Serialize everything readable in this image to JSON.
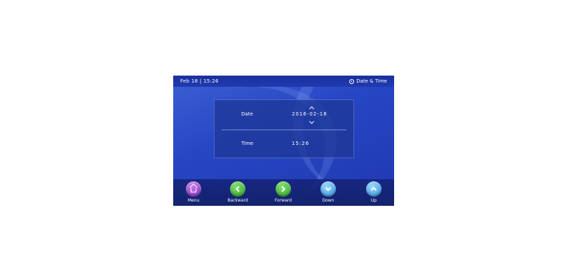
{
  "status_bar": {
    "datetime": "Feb 18 | 15:26",
    "page_title": "Date & Time",
    "page_icon": "clock-icon"
  },
  "settings": {
    "date_label": "Date",
    "date_value": "2016-02-18",
    "time_label": "Time",
    "time_value": "15:26"
  },
  "toolbar": {
    "menu_label": "Menu",
    "backward_label": "Backward",
    "forward_label": "Forward",
    "down_label": "Down",
    "up_label": "Up"
  },
  "colors": {
    "screen_bg": "#2746c4",
    "menu_button": "#8a2fc4",
    "nav_button": "#2ea22a",
    "updown_button": "#2f8fde"
  }
}
